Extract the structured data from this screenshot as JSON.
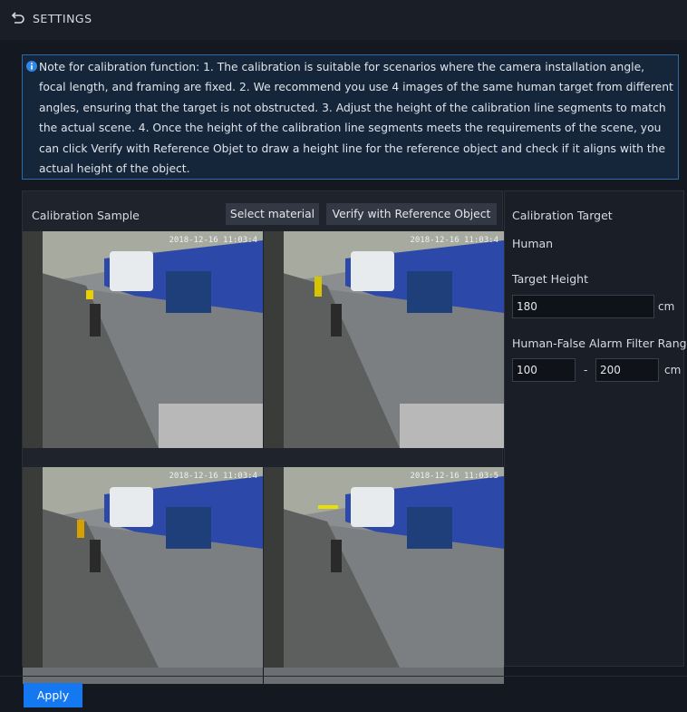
{
  "header": {
    "title": "SETTINGS",
    "icon": "back-arrow-icon"
  },
  "note": {
    "icon": "info-icon",
    "text": "Note for calibration function: 1. The calibration is suitable for scenarios where the camera installation angle, focal length, and framing are fixed. 2. We recommend you use 4 images of the same human target from different angles, ensuring that the target is not obstructed. 3. Adjust the height of the calibration line segments to match the actual scene. 4. Once the height of the calibration line segments meets the requirements of the scene, you can click Verify with Reference Objet to draw a height line for the reference object and check if it aligns with the actual height of the object."
  },
  "sample": {
    "title": "Calibration Sample",
    "select_label": "Select material",
    "verify_label": "Verify with Reference Object",
    "images": [
      {
        "timestamp": "2018-12-16 11:03:4"
      },
      {
        "timestamp": "2018-12-16 11:03:4"
      },
      {
        "timestamp": "2018-12-16 11:03:4"
      },
      {
        "timestamp": "2018-12-16 11:03:5"
      }
    ]
  },
  "target": {
    "label": "Calibration Target",
    "value": "Human",
    "height_label": "Target Height",
    "height_value": "180",
    "height_unit": "cm",
    "filter_label": "Human-False Alarm Filter Rang",
    "filter_min": "100",
    "filter_sep": "-",
    "filter_max": "200",
    "filter_unit": "cm"
  },
  "footer": {
    "apply_label": "Apply"
  },
  "colors": {
    "accent": "#1478f0",
    "note_border": "#2f6aa8",
    "background": "#141821"
  }
}
